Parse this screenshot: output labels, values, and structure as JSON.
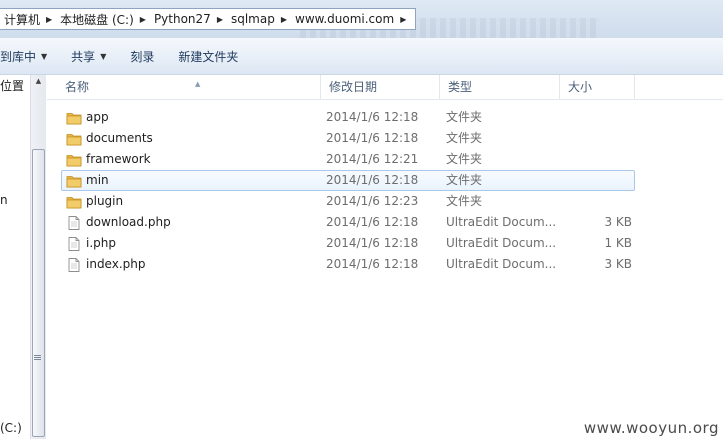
{
  "address_bar": {
    "crumbs": [
      "计算机",
      "本地磁盘 (C:)",
      "Python27",
      "sqlmap",
      "www.duomi.com"
    ]
  },
  "toolbar": {
    "include_library": "到库中",
    "share": "共享",
    "burn": "刻录",
    "new_folder": "新建文件夹"
  },
  "nav": {
    "location": "位置",
    "partial_item": "n",
    "drive": "(C:)"
  },
  "columns": {
    "name": "名称",
    "date": "修改日期",
    "type": "类型",
    "size": "大小"
  },
  "files": [
    {
      "name": "app",
      "date": "2014/1/6 12:18",
      "type": "文件夹",
      "size": "",
      "icon": "folder-icon"
    },
    {
      "name": "documents",
      "date": "2014/1/6 12:18",
      "type": "文件夹",
      "size": "",
      "icon": "folder-icon"
    },
    {
      "name": "framework",
      "date": "2014/1/6 12:21",
      "type": "文件夹",
      "size": "",
      "icon": "folder-icon"
    },
    {
      "name": "min",
      "date": "2014/1/6 12:18",
      "type": "文件夹",
      "size": "",
      "icon": "folder-icon",
      "selected": true
    },
    {
      "name": "plugin",
      "date": "2014/1/6 12:23",
      "type": "文件夹",
      "size": "",
      "icon": "folder-icon"
    },
    {
      "name": "download.php",
      "date": "2014/1/6 12:18",
      "type": "UltraEdit Docum...",
      "size": "3 KB",
      "icon": "document-icon"
    },
    {
      "name": "i.php",
      "date": "2014/1/6 12:18",
      "type": "UltraEdit Docum...",
      "size": "1 KB",
      "icon": "document-icon"
    },
    {
      "name": "index.php",
      "date": "2014/1/6 12:18",
      "type": "UltraEdit Docum...",
      "size": "3 KB",
      "icon": "document-icon"
    }
  ],
  "watermark": "www.wooyun.org",
  "colors": {
    "selection_border": "#a9c8ea",
    "folder": "#e8b547",
    "header_text": "#4c607a"
  }
}
